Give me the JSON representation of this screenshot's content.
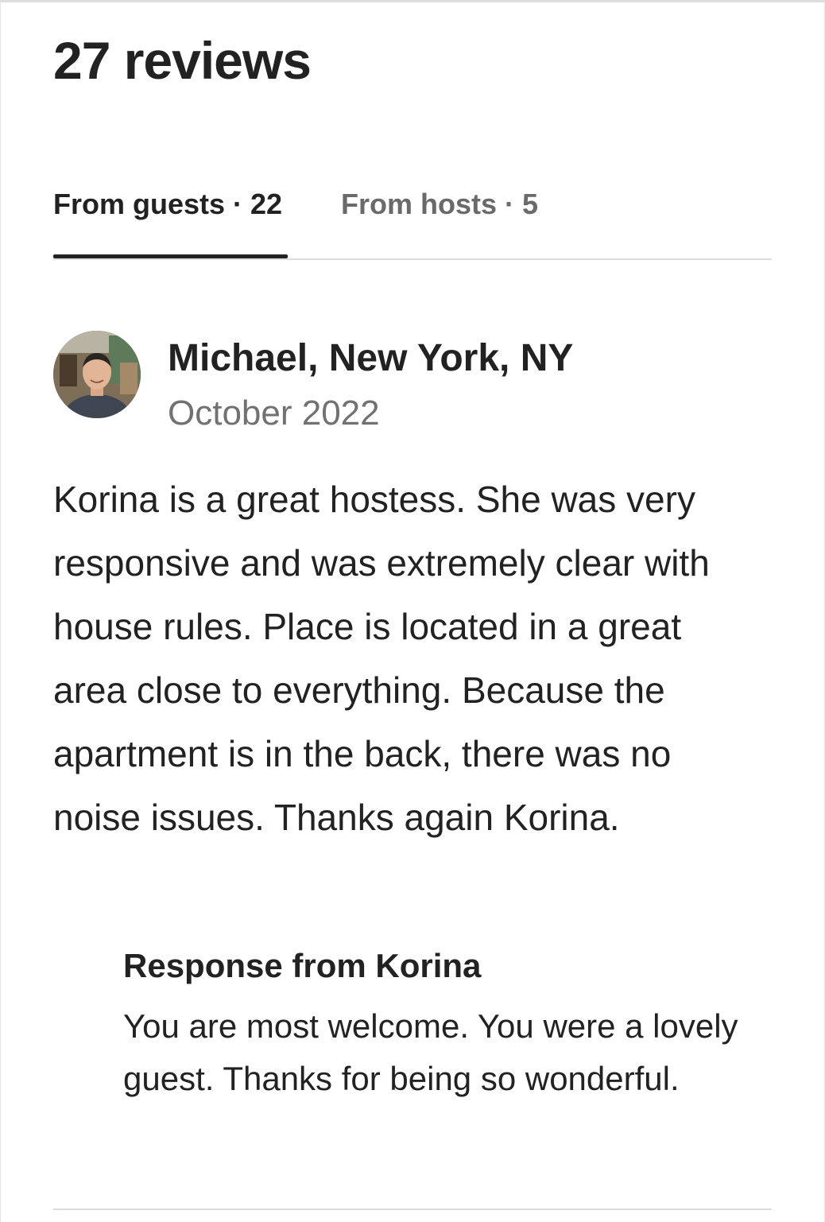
{
  "reviews_header": {
    "title": "27 reviews"
  },
  "tabs": [
    {
      "label": "From guests · 22",
      "selected": true
    },
    {
      "label": "From hosts · 5",
      "selected": false
    }
  ],
  "review": {
    "reviewer": "Michael, New York, NY",
    "date": "October 2022",
    "text": "Korina is a great hostess.  She was very responsive and was extremely clear with house rules.  Place is located in a great area close to everything.  Because the apartment is in the back, there was no noise issues.  Thanks again Korina.",
    "response": {
      "title": "Response from Korina",
      "text": "You are most welcome. You were a lovely guest. Thanks for being so wonderful."
    }
  },
  "colors": {
    "text_primary": "#222222",
    "text_secondary": "#717171",
    "divider": "#dddddd",
    "tab_indicator": "#222222"
  }
}
